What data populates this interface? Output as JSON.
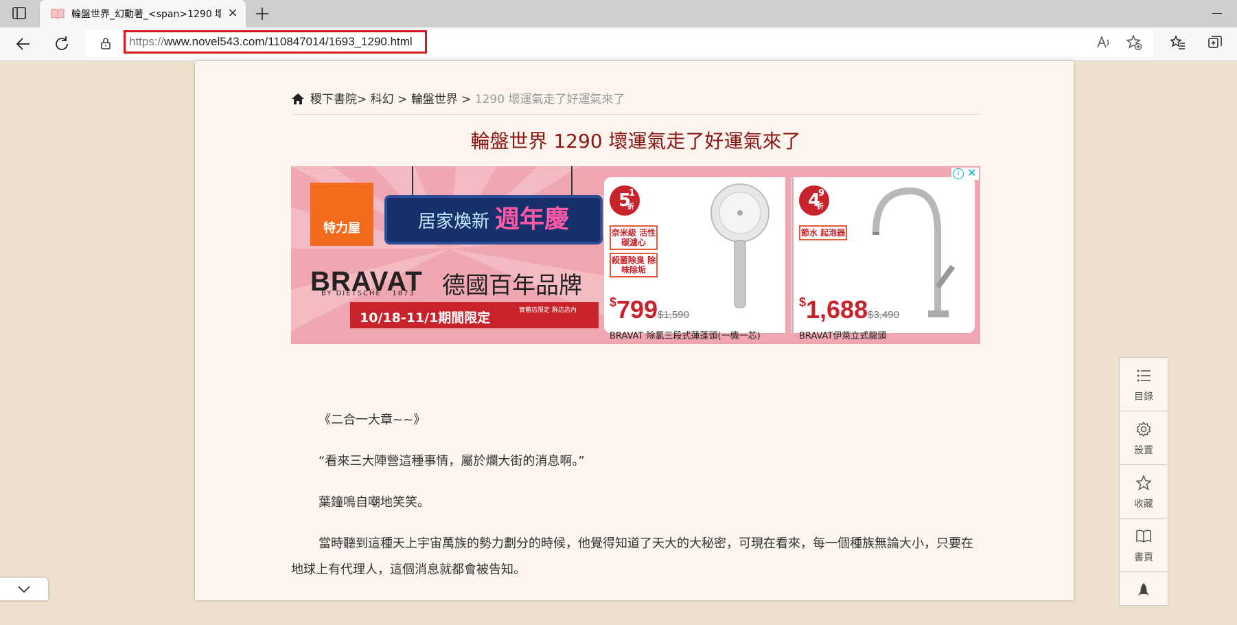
{
  "browser": {
    "tab_title": "輪盤世界_幻動著_<span>1290 壞",
    "url_scheme": "https://",
    "url_rest": "www.novel543.com/110847014/1693_1290.html"
  },
  "breadcrumb": {
    "site": "稷下書院",
    "category": "科幻",
    "book": "輪盤世界",
    "sep": ">",
    "current": "1290 壞運氣走了好運氣來了"
  },
  "chapter_title": "輪盤世界 1290 壞運氣走了好運氣來了",
  "ad": {
    "store_logo": "特力屋",
    "banner_a": "居家煥新",
    "banner_b": "週年慶",
    "brand": "BRAVAT",
    "brand_sub": "BY DIETSCHE · 1873",
    "brand_tagline": "德國百年品牌",
    "period": "10/18-11/1期間限定",
    "period_note": "實體店限定 群店店內",
    "product1": {
      "discount": "5",
      "discount_frac": "1",
      "unit": "折",
      "tag1": "奈米級 活性碳濾心",
      "tag2": "殺菌除臭 除味除垢",
      "currency": "$",
      "price": "799",
      "old_price": "$1,590",
      "name": "BRAVAT 除氯三段式蓮蓬頭(一機一芯)"
    },
    "product2": {
      "discount": "4",
      "discount_frac": "9",
      "unit": "折",
      "tag1": "節水 起泡器",
      "currency": "$",
      "price": "1,688",
      "old_price": "$3,490",
      "name": "BRAVAT伊萊立式龍頭"
    }
  },
  "content": {
    "p1": "《二合一大章~~》",
    "p2": "“看來三大陣營這種事情，屬於爛大街的消息啊。”",
    "p3": "葉鐘鳴自嘲地笑笑。",
    "p4": "當時聽到這種天上宇宙萬族的勢力劃分的時候，他覺得知道了天大的大秘密，可現在看來，每一個種族無論大小，只要在地球上有代理人，這個消息就都會被告知。"
  },
  "sidebar": {
    "toc": "目錄",
    "settings": "設置",
    "favorite": "收藏",
    "bookmark": "書頁"
  }
}
